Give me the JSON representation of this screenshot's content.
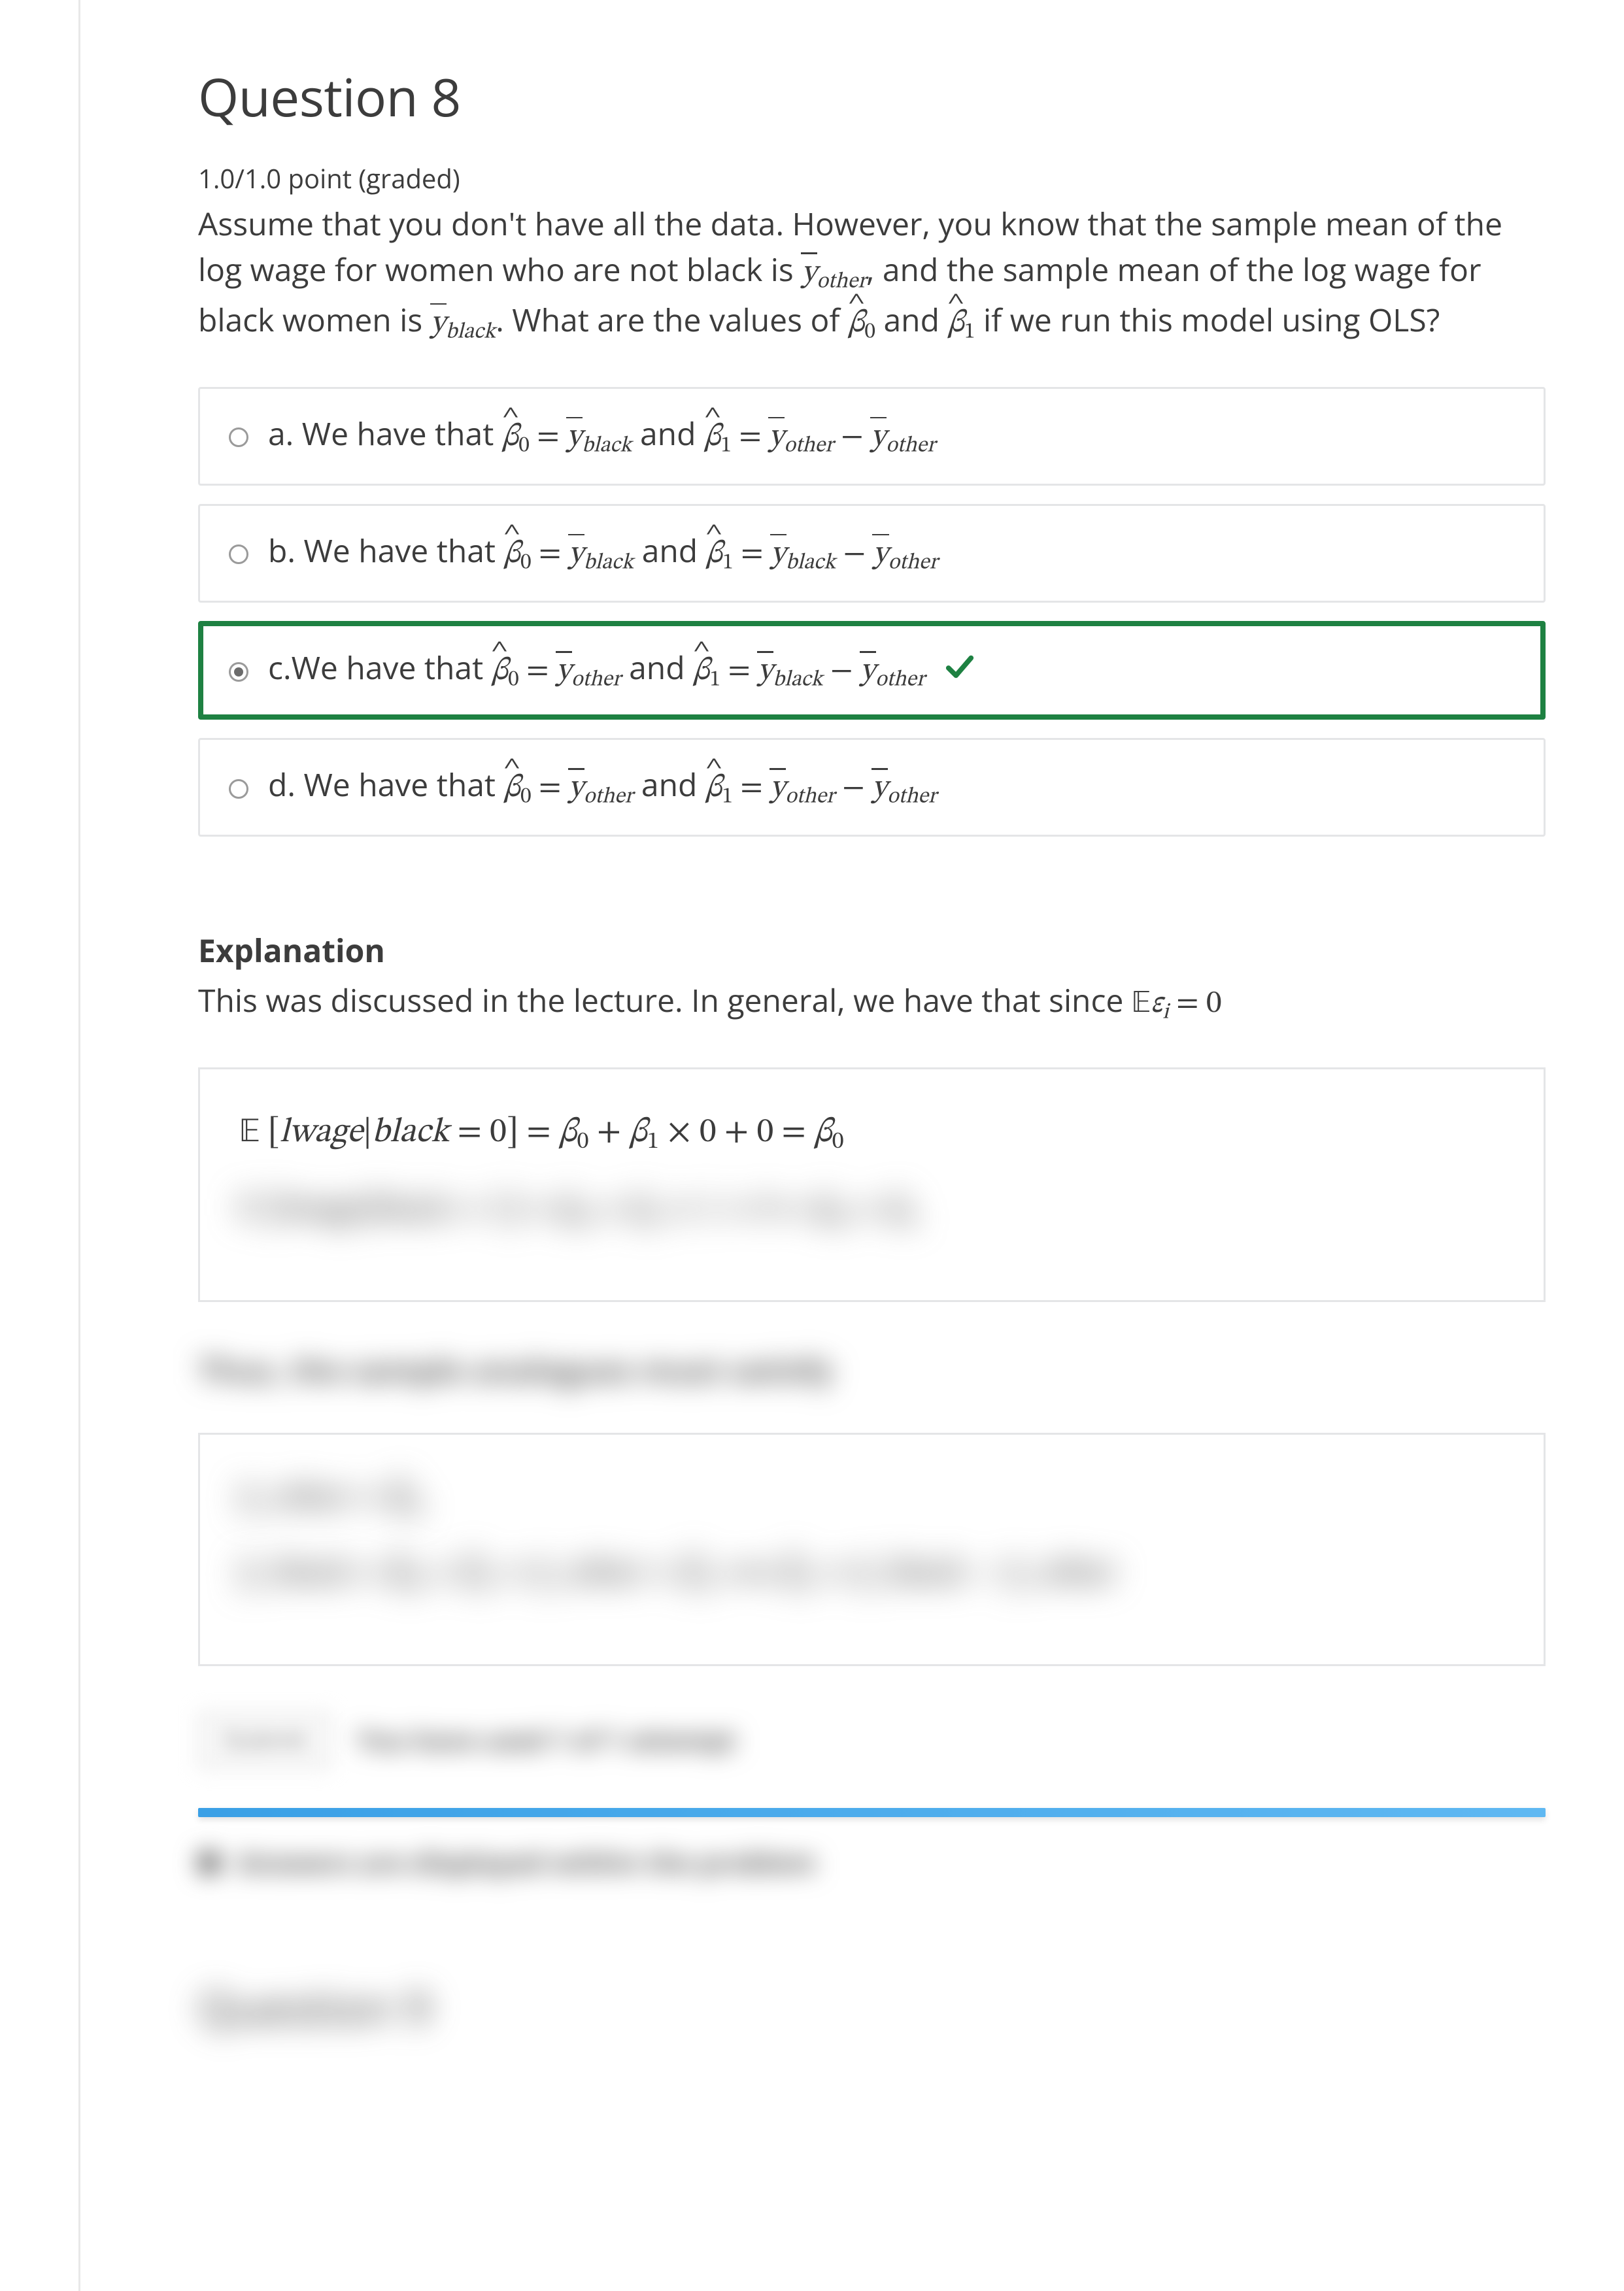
{
  "question": {
    "title": "Question 8",
    "grade": "1.0/1.0 point (graded)",
    "prompt_parts": {
      "p1": "Assume that you don't have all the data. However, you know that the sample mean of the log wage for women who are not black is ",
      "p2": ", and the sample mean of the log wage for black women is ",
      "p3": ". What are the values of ",
      "p4": " and ",
      "p5": " if we run this model using OLS?"
    },
    "choices": {
      "a": {
        "letter": "a.",
        "lead": " We have that ",
        "and": " and ",
        "correct": false,
        "checked": false
      },
      "b": {
        "letter": "b.",
        "lead": " We have that ",
        "and": " and ",
        "correct": false,
        "checked": false
      },
      "c": {
        "letter": "c.",
        "lead": "We have that ",
        "and": " and ",
        "correct": true,
        "checked": true
      },
      "d": {
        "letter": "d.",
        "lead": " We have that ",
        "and": " and ",
        "correct": false,
        "checked": false
      }
    }
  },
  "explanation": {
    "heading": "Explanation",
    "intro_p1": "This was discussed in the lecture. In general, we have that since ",
    "eq1_lhs": "𝔼 [lwage|black = 0] = ",
    "eq1_rhs": " × 0 + 0 = ",
    "blurred_eq2": "𝔼 [lwage|black = 1] = β₀ + β₁ × 1 + 0 = β₀ + β₁",
    "blurred_sentence": "Thus, the sample analogues must satisfy",
    "blurred_box2_l1": "ȳ_other = β̂₀",
    "blurred_box2_l2": "ȳ_black = β̂₀ + β̂₁ = ȳ_other + β̂₁  ⟹  β̂₁ = ȳ_black − ȳ_other"
  },
  "footer": {
    "submit_label": "Submit",
    "attempts_text": "You have used 1 of 1 attempt",
    "info_text": "Answers are displayed within the problem",
    "next_title": "Question 9"
  }
}
